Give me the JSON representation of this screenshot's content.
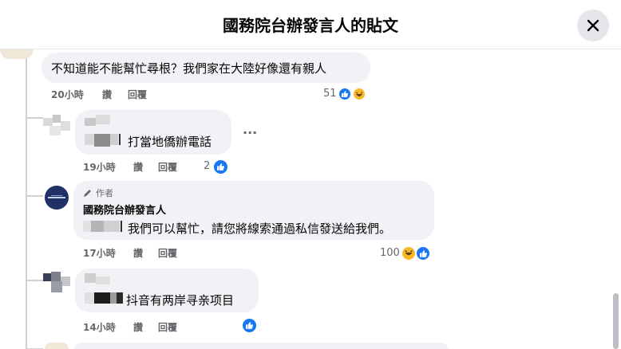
{
  "header": {
    "title": "國務院台辦發言人的貼文",
    "close_icon": "close-icon"
  },
  "comments": [
    {
      "text": "不知道能不能幫忙尋根？我們家在大陸好像還有親人",
      "time": "20小時",
      "like": "讚",
      "reply": "回覆",
      "count": "51",
      "reactions": [
        "like",
        "haha"
      ]
    },
    {
      "text": "打當地僑辦電話",
      "time": "19小時",
      "like": "讚",
      "reply": "回覆",
      "count": "2",
      "reactions": [
        "like"
      ],
      "more": "···"
    },
    {
      "badge": "作者",
      "author": "國務院台辦發言人",
      "text": "我們可以幫忙，請您將線索通過私信發送給我們。",
      "time": "17小時",
      "like": "讚",
      "reply": "回覆",
      "count": "100",
      "reactions": [
        "haha",
        "like"
      ]
    },
    {
      "text": "抖音有两岸寻亲项目",
      "time": "14小時",
      "like": "讚",
      "reply": "回覆",
      "count": "",
      "reactions": [
        "like"
      ]
    }
  ],
  "colors": {
    "like": "#1877f2",
    "haha": "#f7b928",
    "bubble": "#f0f2f5",
    "meta": "#65676b"
  }
}
